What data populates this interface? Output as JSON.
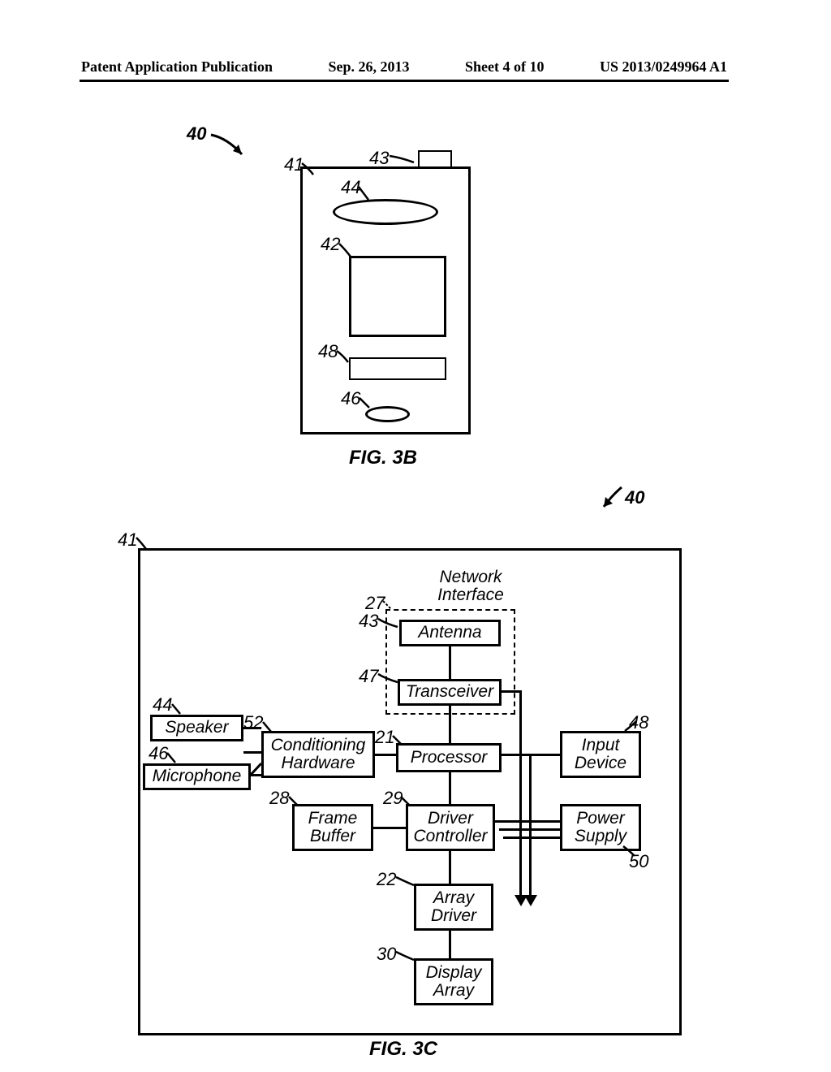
{
  "header": {
    "publication": "Patent Application Publication",
    "date": "Sep. 26, 2013",
    "sheet": "Sheet 4 of 10",
    "pubnum": "US 2013/0249964 A1"
  },
  "figA": {
    "caption": "FIG. 3B",
    "refs": {
      "r40": "40",
      "r41": "41",
      "r43": "43",
      "r44": "44",
      "r42": "42",
      "r48": "48",
      "r46": "46"
    }
  },
  "figB": {
    "caption": "FIG. 3C",
    "refs": {
      "r40": "40",
      "r41": "41",
      "r27": "27",
      "r43": "43",
      "r47": "47",
      "r44": "44",
      "r52": "52",
      "r21": "21",
      "r46": "46",
      "r48": "48",
      "r28": "28",
      "r29": "29",
      "r22": "22",
      "r30": "30",
      "r50": "50"
    },
    "blocks": {
      "network": "Network\nInterface",
      "antenna": "Antenna",
      "transceiver": "Transceiver",
      "speaker": "Speaker",
      "microphone": "Microphone",
      "conditioning": "Conditioning\nHardware",
      "processor": "Processor",
      "input": "Input\nDevice",
      "frame": "Frame\nBuffer",
      "driver": "Driver\nController",
      "power": "Power\nSupply",
      "array": "Array\nDriver",
      "display": "Display\nArray"
    }
  }
}
